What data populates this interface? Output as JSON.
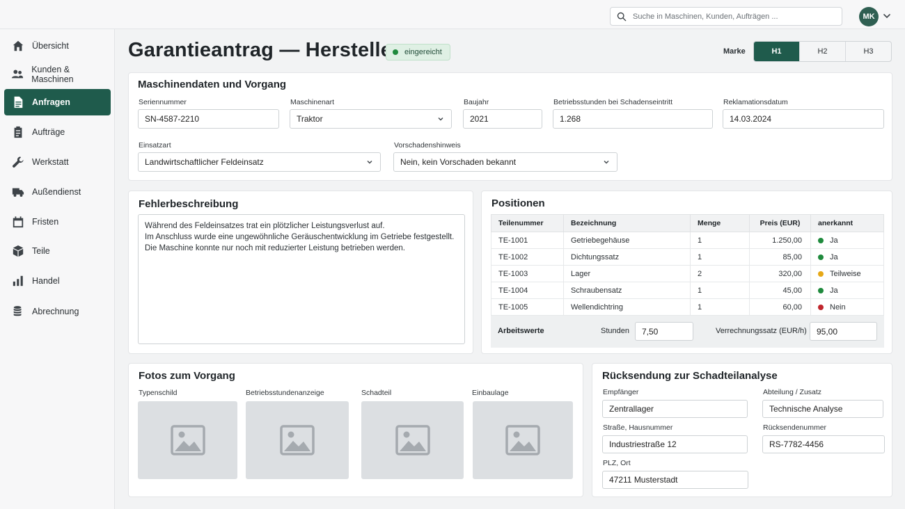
{
  "search": {
    "placeholder": "Suche in Maschinen, Kunden, Aufträgen ..."
  },
  "user": {
    "initials": "MK"
  },
  "sidebar": {
    "items": [
      {
        "label": "Übersicht",
        "icon": "home-icon"
      },
      {
        "label": "Kunden & Maschinen",
        "icon": "users-icon"
      },
      {
        "label": "Anfragen",
        "icon": "document-icon",
        "active": true
      },
      {
        "label": "Aufträge",
        "icon": "clipboard-icon"
      },
      {
        "label": "Werkstatt",
        "icon": "wrench-icon"
      },
      {
        "label": "Außendienst",
        "icon": "truck-icon"
      },
      {
        "label": "Fristen",
        "icon": "calendar-icon"
      },
      {
        "label": "Teile",
        "icon": "box-icon"
      },
      {
        "label": "Handel",
        "icon": "bar-chart-icon"
      },
      {
        "label": "Abrechnung",
        "icon": "coins-icon"
      }
    ]
  },
  "header": {
    "title": "Garantieantrag — Hersteller",
    "status": "eingereicht",
    "brand_label": "Marke",
    "brand_options": [
      "H1",
      "H2",
      "H3"
    ],
    "brand_selected": "H1"
  },
  "machine": {
    "title": "Maschinendaten und Vorgang",
    "serial_label": "Seriennummer",
    "serial_value": "SN-4587-2210",
    "type_label": "Maschinenart",
    "type_value": "Traktor",
    "year_label": "Baujahr",
    "year_value": "2021",
    "hours_label": "Betriebsstunden bei Schadenseintritt",
    "hours_value": "1.268",
    "claim_date_label": "Reklamationsdatum",
    "claim_date_value": "14.03.2024",
    "usage_label": "Einsatzart",
    "usage_value": "Landwirtschaftlicher Feldeinsatz",
    "prior_label": "Vorschadenshinweis",
    "prior_value": "Nein, kein Vorschaden bekannt"
  },
  "fault": {
    "title": "Fehlerbeschreibung",
    "text_line1": "Während des Feldeinsatzes trat ein plötzlicher Leistungsverlust auf.",
    "text_line2": "Im Anschluss wurde eine ungewöhnliche Geräuschentwicklung im Getriebe festgestellt.",
    "text_line3": "Die Maschine konnte nur noch mit reduzierter Leistung betrieben werden."
  },
  "positions": {
    "title": "Positionen",
    "headers": [
      "Teilenummer",
      "Bezeichnung",
      "Menge",
      "Preis (EUR)",
      "anerkannt"
    ],
    "rows": [
      {
        "part": "TE-1001",
        "name": "Getriebegehäuse",
        "qty": "1",
        "price": "1.250,00",
        "status": "Ja",
        "color": "#1f8a3d"
      },
      {
        "part": "TE-1002",
        "name": "Dichtungssatz",
        "qty": "1",
        "price": "85,00",
        "status": "Ja",
        "color": "#1f8a3d"
      },
      {
        "part": "TE-1003",
        "name": "Lager",
        "qty": "2",
        "price": "320,00",
        "status": "Teilweise",
        "color": "#e6a817"
      },
      {
        "part": "TE-1004",
        "name": "Schraubensatz",
        "qty": "1",
        "price": "45,00",
        "status": "Ja",
        "color": "#1f8a3d"
      },
      {
        "part": "TE-1005",
        "name": "Wellendichtring",
        "qty": "1",
        "price": "60,00",
        "status": "Nein",
        "color": "#c0262d"
      }
    ],
    "labor_label": "Arbeitswerte",
    "hours_label": "Stunden",
    "hours_value": "7,50",
    "rate_label": "Verrechnungssatz  (EUR/h)",
    "rate_value": "95,00"
  },
  "photos": {
    "title": "Fotos zum Vorgang",
    "items": [
      "Typenschild",
      "Betriebsstundenanzeige",
      "Schadteil",
      "Einbaulage"
    ]
  },
  "return": {
    "title": "Rücksendung zur Schadteilanalyse",
    "recipient_label": "Empfänger",
    "recipient_value": "Zentrallager",
    "dept_label": "Abteilung / Zusatz",
    "dept_value": "Technische Analyse",
    "street_label": "Straße, Hausnummer",
    "street_value": "Industriestraße 12",
    "return_no_label": "Rücksendenummer",
    "return_no_value": "RS-7782-4456",
    "city_label": "PLZ, Ort",
    "city_value": "47211 Musterstadt"
  },
  "colors": {
    "accent": "#1f5b4c",
    "ok": "#1f8a3d",
    "partial": "#e6a817",
    "rejected": "#c0262d"
  }
}
